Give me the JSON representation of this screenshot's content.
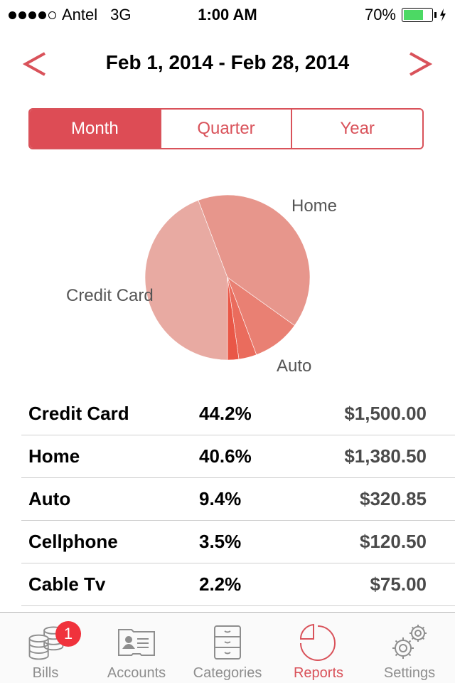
{
  "status_bar": {
    "signal_bars_filled": 4,
    "signal_bars_total": 5,
    "carrier": "Antel",
    "network": "3G",
    "time": "1:00 AM",
    "battery_percent_label": "70%",
    "battery_level": 0.7,
    "charging": true,
    "battery_color": "#4cd964"
  },
  "header": {
    "prev_icon": "chevron-left-icon",
    "next_icon": "chevron-right-icon",
    "date_range": "Feb 1, 2014 - Feb 28, 2014",
    "accent_color": "#d9525a"
  },
  "period_selector": {
    "options": [
      {
        "label": "Month",
        "selected": true
      },
      {
        "label": "Quarter",
        "selected": false
      },
      {
        "label": "Year",
        "selected": false
      }
    ]
  },
  "chart_data": {
    "type": "pie",
    "title": "",
    "slices": [
      {
        "label": "Credit Card",
        "value": 44.2,
        "color": "#e8aaa2",
        "show_label": true
      },
      {
        "label": "Home",
        "value": 40.6,
        "color": "#e7968c",
        "show_label": true
      },
      {
        "label": "Auto",
        "value": 9.4,
        "color": "#e98073",
        "show_label": true
      },
      {
        "label": "Cellphone",
        "value": 3.5,
        "color": "#ea6c5d",
        "show_label": false
      },
      {
        "label": "Cable Tv",
        "value": 2.2,
        "color": "#e95747",
        "show_label": false
      }
    ],
    "start": "bottom",
    "direction": "counterclockwise"
  },
  "breakdown": {
    "rows": [
      {
        "category": "Credit Card",
        "percent": "44.2%",
        "amount": "$1,500.00"
      },
      {
        "category": "Home",
        "percent": "40.6%",
        "amount": "$1,380.50"
      },
      {
        "category": "Auto",
        "percent": "9.4%",
        "amount": "$320.85"
      },
      {
        "category": "Cellphone",
        "percent": "3.5%",
        "amount": "$120.50"
      },
      {
        "category": "Cable Tv",
        "percent": "2.2%",
        "amount": "$75.00"
      }
    ]
  },
  "tab_bar": {
    "items": [
      {
        "label": "Bills",
        "icon": "coins-stack-icon",
        "badge": "1",
        "active": false
      },
      {
        "label": "Accounts",
        "icon": "contact-card-icon",
        "active": false
      },
      {
        "label": "Categories",
        "icon": "file-cabinet-icon",
        "active": false
      },
      {
        "label": "Reports",
        "icon": "pie-chart-icon",
        "active": true
      },
      {
        "label": "Settings",
        "icon": "gears-icon",
        "active": false
      }
    ]
  }
}
